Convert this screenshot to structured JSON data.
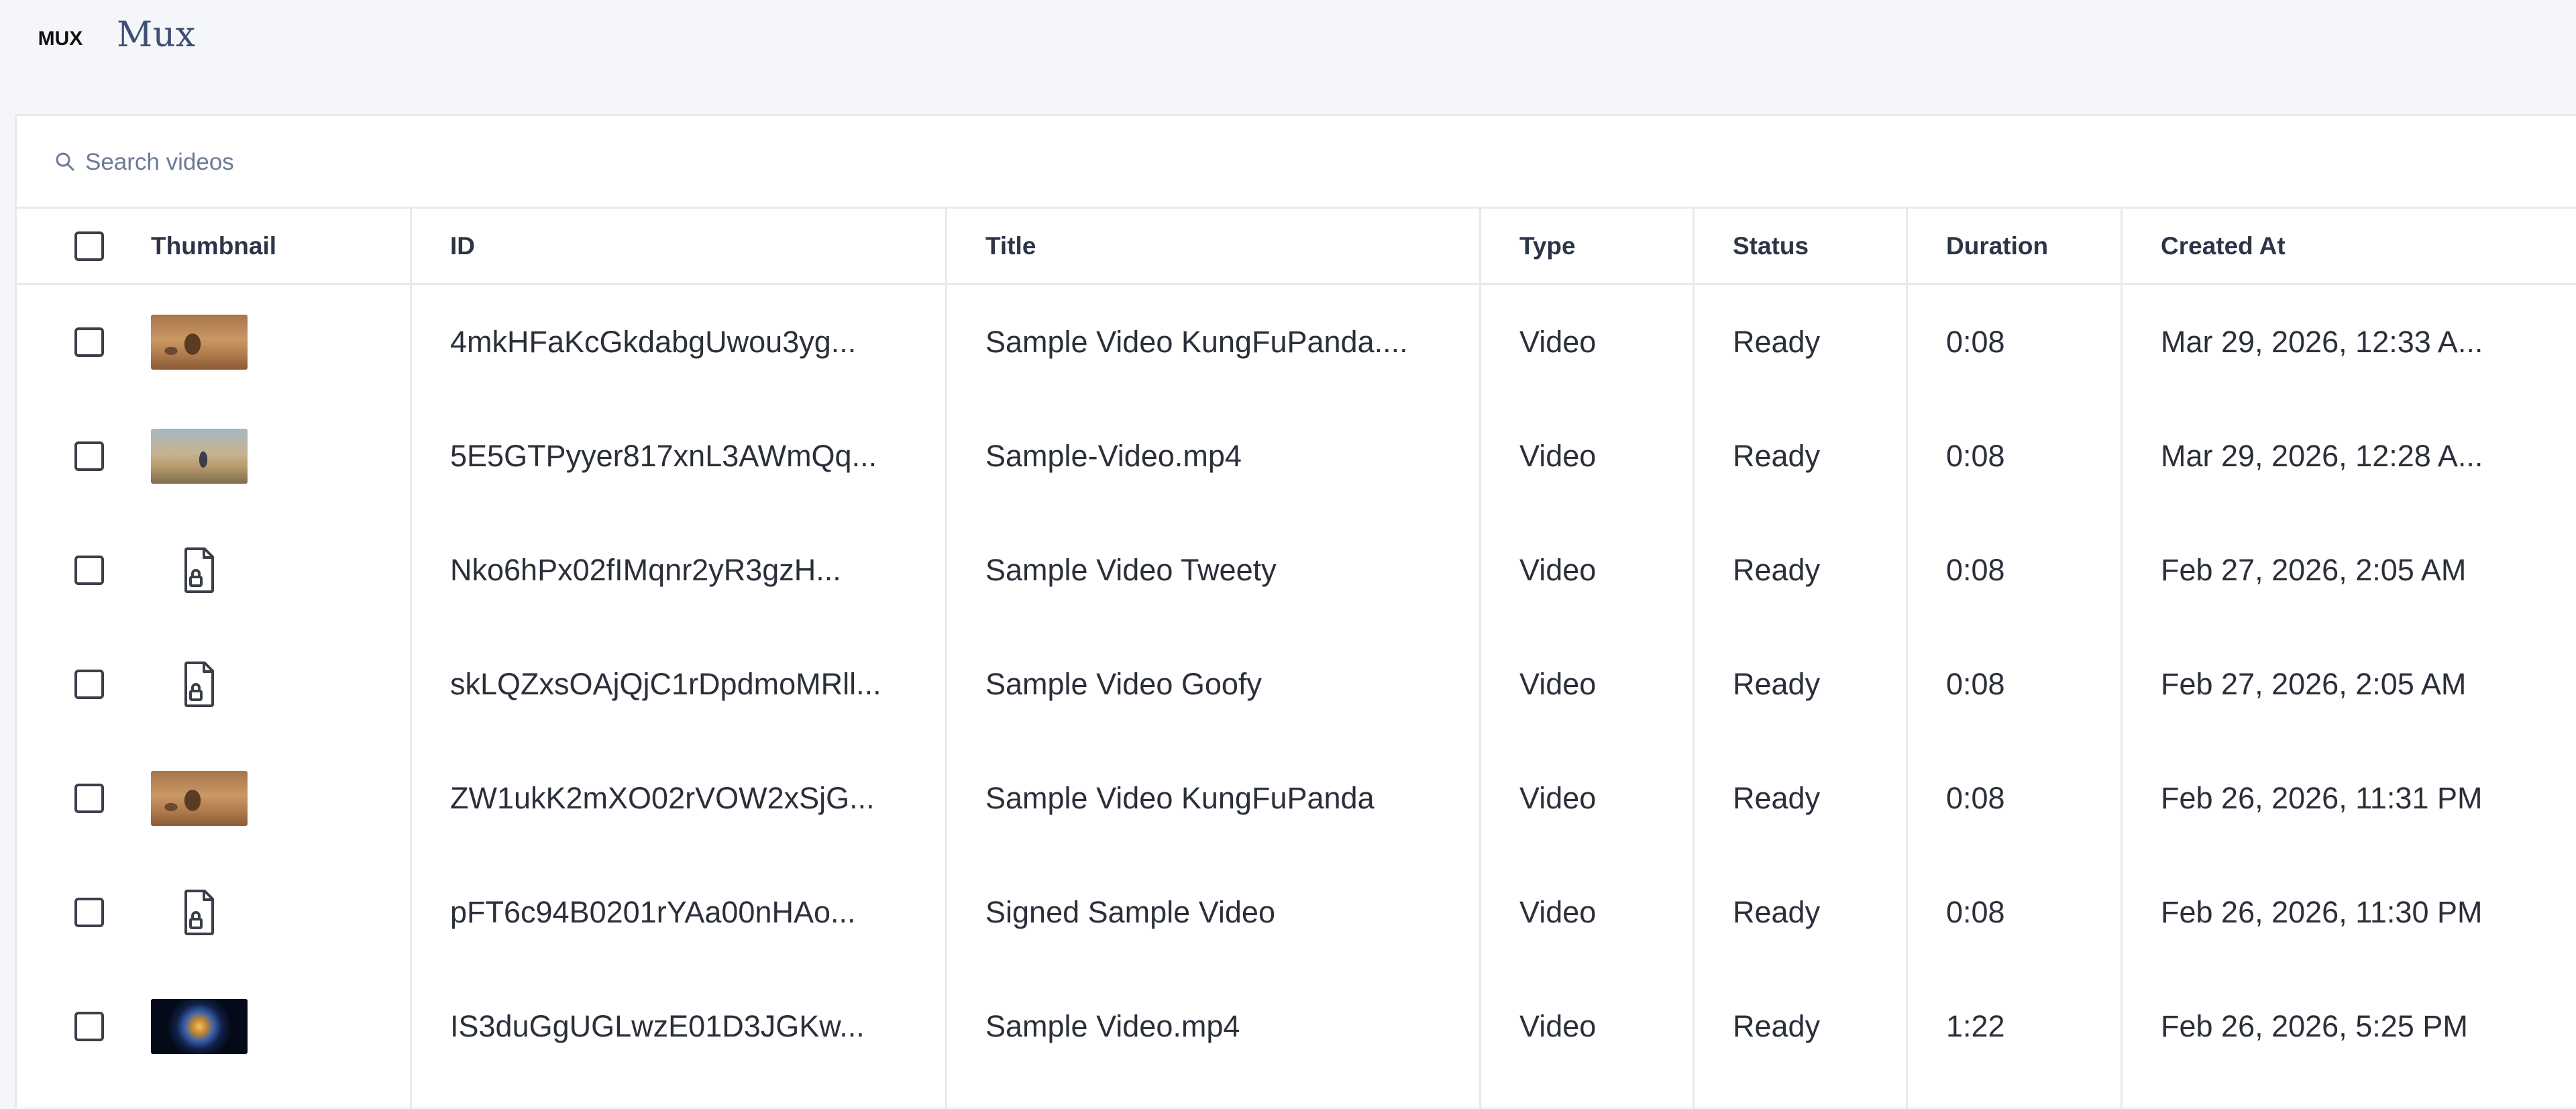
{
  "app": {
    "logo_text": "MUX",
    "brand_name": "Mux"
  },
  "search": {
    "placeholder": "Search videos",
    "value": ""
  },
  "table": {
    "columns": {
      "thumbnail": "Thumbnail",
      "id": "ID",
      "title": "Title",
      "type": "Type",
      "status": "Status",
      "duration": "Duration",
      "created_at": "Created At"
    },
    "rows": [
      {
        "thumbnail": "panda-frame",
        "id": "4mkHFaKcGkdabgUwou3yg...",
        "title": "Sample Video KungFuPanda....",
        "type": "Video",
        "status": "Ready",
        "duration": "0:08",
        "created_at": "Mar 29, 2026, 12:33 A..."
      },
      {
        "thumbnail": "road-frame",
        "id": "5E5GTPyyer817xnL3AWmQq...",
        "title": "Sample-Video.mp4",
        "type": "Video",
        "status": "Ready",
        "duration": "0:08",
        "created_at": "Mar 29, 2026, 12:28 A..."
      },
      {
        "thumbnail": "locked-file-icon",
        "id": "Nko6hPx02fIMqnr2yR3gzH...",
        "title": "Sample Video Tweety",
        "type": "Video",
        "status": "Ready",
        "duration": "0:08",
        "created_at": "Feb 27, 2026, 2:05 AM"
      },
      {
        "thumbnail": "locked-file-icon",
        "id": "skLQZxsOAjQjC1rDpdmoMRll...",
        "title": "Sample Video Goofy",
        "type": "Video",
        "status": "Ready",
        "duration": "0:08",
        "created_at": "Feb 27, 2026, 2:05 AM"
      },
      {
        "thumbnail": "panda-frame",
        "id": "ZW1ukK2mXO02rVOW2xSjG...",
        "title": "Sample Video KungFuPanda",
        "type": "Video",
        "status": "Ready",
        "duration": "0:08",
        "created_at": "Feb 26, 2026, 11:31 PM"
      },
      {
        "thumbnail": "locked-file-icon",
        "id": "pFT6c94B0201rYAa00nHAo...",
        "title": "Signed Sample Video",
        "type": "Video",
        "status": "Ready",
        "duration": "0:08",
        "created_at": "Feb 26, 2026, 11:30 PM"
      },
      {
        "thumbnail": "galaxy-frame",
        "id": "IS3duGgUGLwzE01D3JGKw...",
        "title": "Sample Video.mp4",
        "type": "Video",
        "status": "Ready",
        "duration": "1:22",
        "created_at": "Feb 26, 2026, 5:25 PM"
      }
    ]
  },
  "colors": {
    "background": "#f4f6fa",
    "panel": "#ffffff",
    "border": "#e6e9ef",
    "brand_text": "#3e4f73",
    "placeholder": "#6c7a96"
  }
}
